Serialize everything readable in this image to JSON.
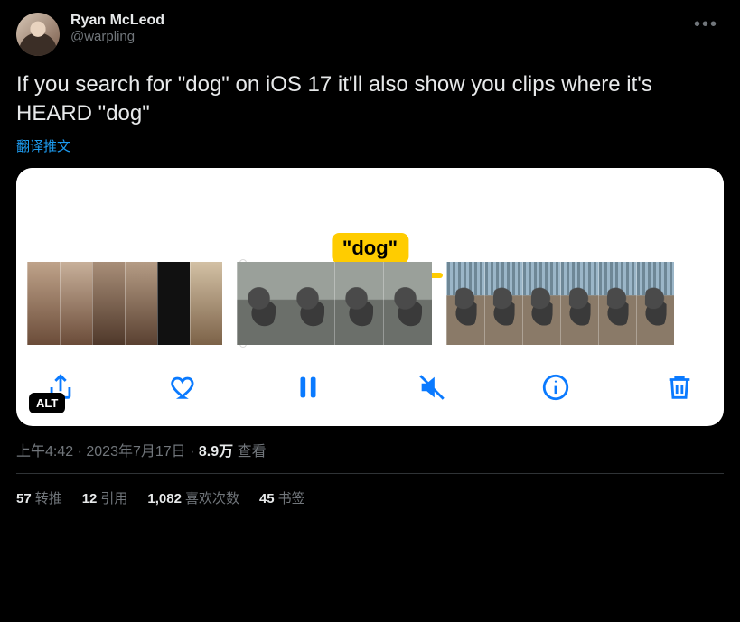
{
  "author": {
    "display_name": "Ryan McLeod",
    "handle": "@warpling"
  },
  "body": "If you search for \"dog\" on iOS 17 it'll also show you clips where it's HEARD \"dog\"",
  "translate_label": "翻译推文",
  "media": {
    "caption_text": "\"dog\"",
    "alt_badge": "ALT",
    "toolbar": {
      "share": "share-icon",
      "like": "heart-icon",
      "pause": "pause-icon",
      "mute": "mute-icon",
      "info": "info-icon",
      "trash": "trash-icon"
    }
  },
  "meta": {
    "time": "上午4:42",
    "dot": " · ",
    "date": "2023年7月17日",
    "views_value": "8.9万",
    "views_label": " 查看"
  },
  "stats": {
    "retweets": {
      "value": "57",
      "label": "转推"
    },
    "quotes": {
      "value": "12",
      "label": "引用"
    },
    "likes": {
      "value": "1,082",
      "label": "喜欢次数"
    },
    "bookmarks": {
      "value": "45",
      "label": "书签"
    }
  }
}
